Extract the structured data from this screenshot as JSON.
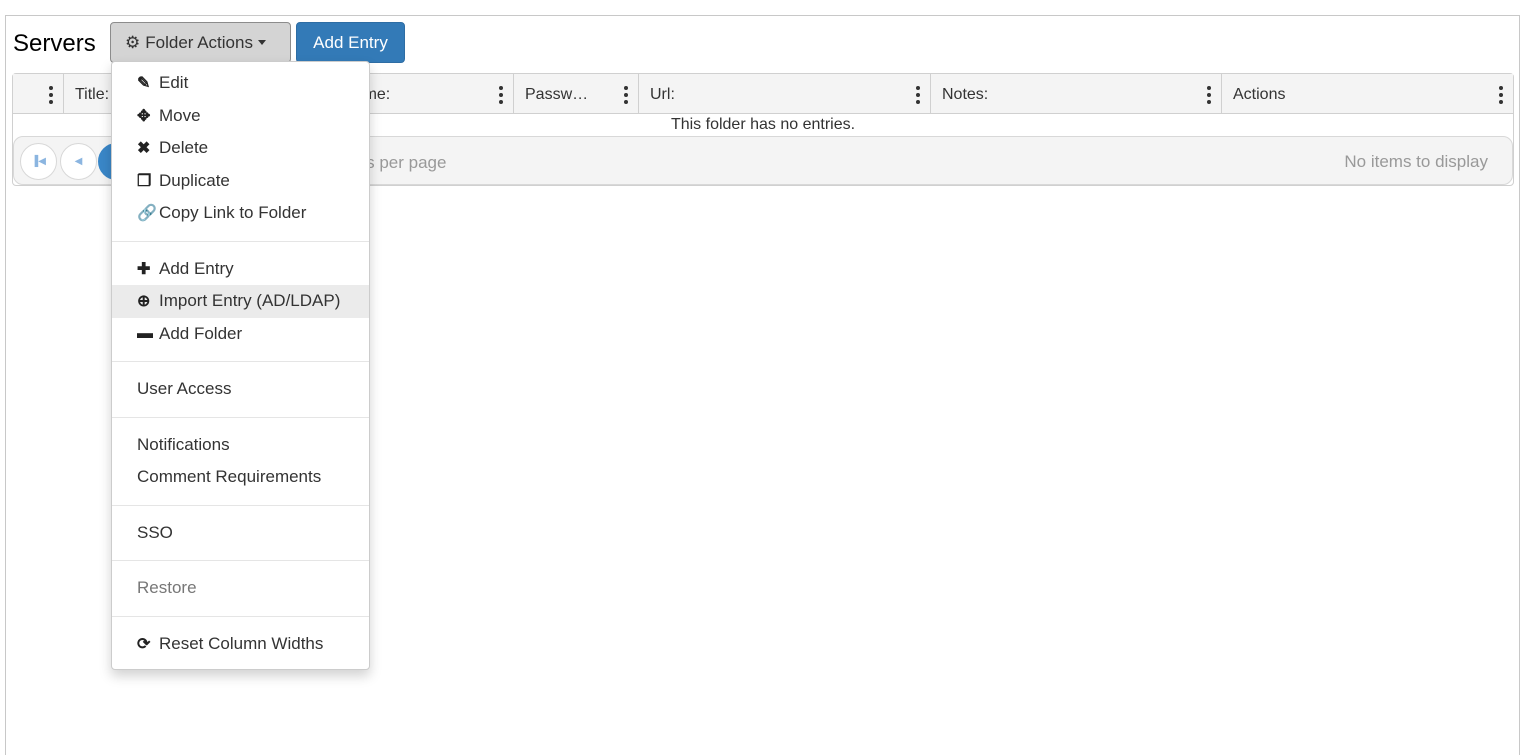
{
  "page": {
    "title": "Servers"
  },
  "toolbar": {
    "folder_actions": "Folder Actions",
    "add_entry": "Add Entry"
  },
  "grid": {
    "columns": [
      "",
      "Title:",
      "Username:",
      "Passw…",
      "Url:",
      "Notes:",
      "Actions"
    ],
    "empty_message": "This folder has no entries.",
    "pager": {
      "per_page_label": "items per page",
      "status": "No items to display",
      "current_page": "1"
    }
  },
  "menu": {
    "groups": [
      [
        {
          "label": "Edit",
          "icon": "pencil-icon"
        },
        {
          "label": "Move",
          "icon": "move-icon"
        },
        {
          "label": "Delete",
          "icon": "x-icon"
        },
        {
          "label": "Duplicate",
          "icon": "duplicate-icon"
        },
        {
          "label": "Copy Link to Folder",
          "icon": "link-icon"
        }
      ],
      [
        {
          "label": "Add Entry",
          "icon": "plus-icon"
        },
        {
          "label": "Import Entry (AD/LDAP)",
          "icon": "import-icon"
        },
        {
          "label": "Add Folder",
          "icon": "folder-icon"
        }
      ],
      [
        {
          "label": "User Access"
        }
      ],
      [
        {
          "label": "Notifications"
        },
        {
          "label": "Comment Requirements"
        }
      ],
      [
        {
          "label": "SSO"
        }
      ],
      [
        {
          "label": "Restore"
        }
      ],
      [
        {
          "label": "Reset Column Widths",
          "icon": "refresh-icon"
        }
      ]
    ],
    "hovered": "Import Entry (AD/LDAP)",
    "disabled": [
      "Restore"
    ]
  },
  "colors": {
    "primary": "#337ab7",
    "hover": "#ebebeb"
  }
}
